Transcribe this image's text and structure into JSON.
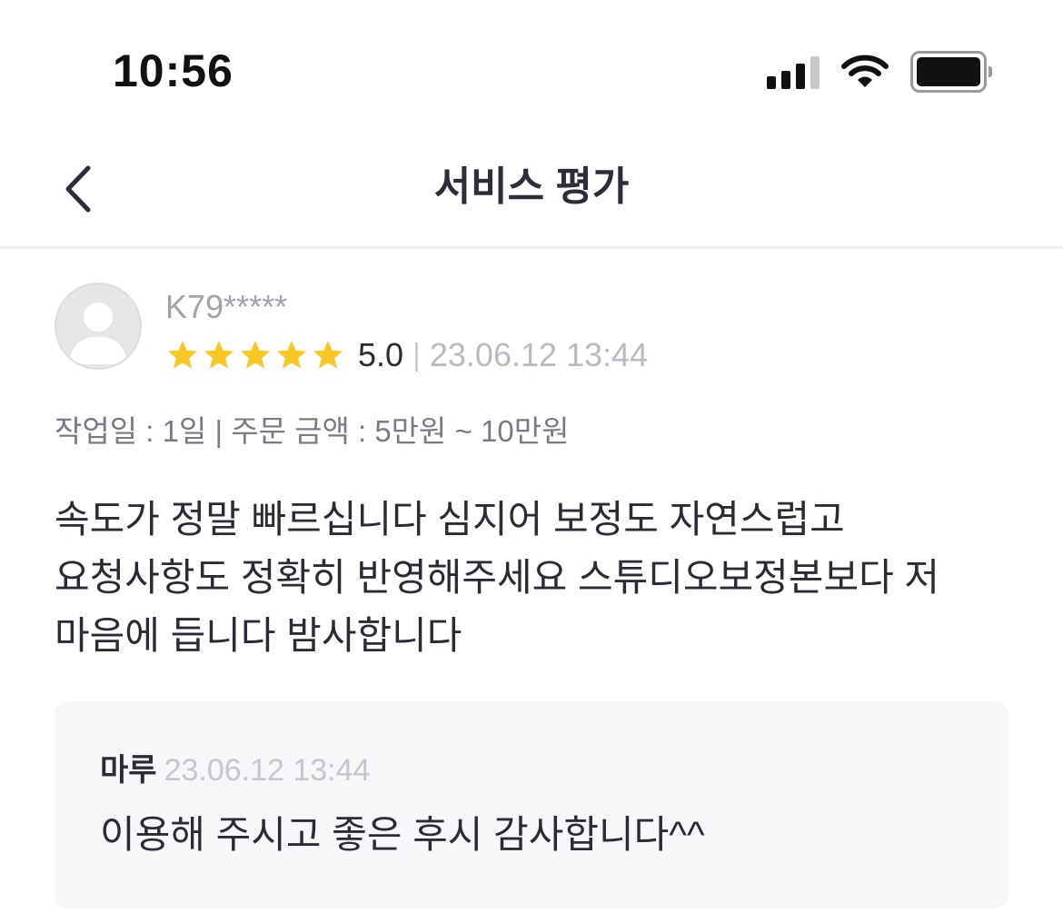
{
  "status_bar": {
    "time": "10:56"
  },
  "header": {
    "title": "서비스 평가"
  },
  "review": {
    "username": "K79*****",
    "star_count": 5,
    "score": "5.0",
    "separator": "|",
    "date": "23.06.12 13:44",
    "meta": "작업일 : 1일 | 주문 금액 : 5만원 ~ 10만원",
    "text": "속도가 정말 빠르십니다 심지어 보정도 자연스럽고 요청사항도 정확히 반영해주세요 스튜디오보정본보다 저 마음에 듭니다 밤사합니다"
  },
  "reply": {
    "author": "마루",
    "date": "23.06.12 13:44",
    "text": "이용해 주시고 좋은 후시 감사합니다^^"
  },
  "colors": {
    "star": "#f7c824",
    "reply_bg": "#f7f7f9"
  },
  "icons": [
    "signal-icon",
    "wifi-icon",
    "battery-icon",
    "back-arrow-icon",
    "avatar-placeholder-icon",
    "star-icon"
  ]
}
